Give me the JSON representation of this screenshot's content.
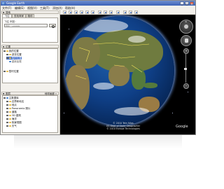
{
  "window": {
    "title": "Google Earth",
    "controls": [
      "_",
      "□",
      "×"
    ]
  },
  "menu": [
    "文件(F)",
    "编辑(E)",
    "视图(V)",
    "工具(T)",
    "添加(A)",
    "帮助(H)"
  ],
  "search_panel": {
    "header": "搜索",
    "tabs": [
      "飞往",
      "查找商家",
      "路线"
    ],
    "hint": "飞往 例如：",
    "input_placeholder": "例如：100000"
  },
  "places_panel": {
    "header": "位置",
    "items": [
      {
        "label": "我的位置",
        "icon": "folder-icon"
      },
      {
        "label": "游览位置",
        "icon": "folder-icon"
      },
      {
        "label": "临时位置",
        "icon": "folder-icon",
        "selected": true
      },
      {
        "label": "重新加载",
        "icon": "globe-icon"
      },
      {
        "label": "暂时位置",
        "icon": "folder-icon"
      }
    ]
  },
  "layers_panel": {
    "header": "图层",
    "toolbar_label": "地球画廊 »",
    "items": [
      {
        "label": "主数据库",
        "icon": "globe-icon"
      },
      {
        "label": "边界和地名",
        "icon": "folder-icon"
      },
      {
        "label": "地点",
        "icon": "folder-icon"
      },
      {
        "label": "Panoramio 照片",
        "icon": "folder-icon"
      },
      {
        "label": "道路",
        "icon": "folder-icon"
      },
      {
        "label": "3D 建筑",
        "icon": "folder-icon"
      },
      {
        "label": "海洋",
        "icon": "folder-icon"
      },
      {
        "label": "街景视图",
        "icon": "folder-icon"
      },
      {
        "label": "天气",
        "icon": "folder-icon"
      }
    ]
  },
  "view": {
    "credits": [
      "© 2010 Tele Atlas",
      "US Dept of State Geographer",
      "© 2010 Europa Technologies"
    ],
    "logo": "Google",
    "nav_north": "N",
    "zoom_in": "+",
    "zoom_out": "−"
  },
  "colors": {
    "title_bar": "#3c63b8",
    "space": "#000000",
    "ocean": "#0f3f86",
    "land": "#6f7b3f",
    "selection": "#3d6bc9"
  }
}
